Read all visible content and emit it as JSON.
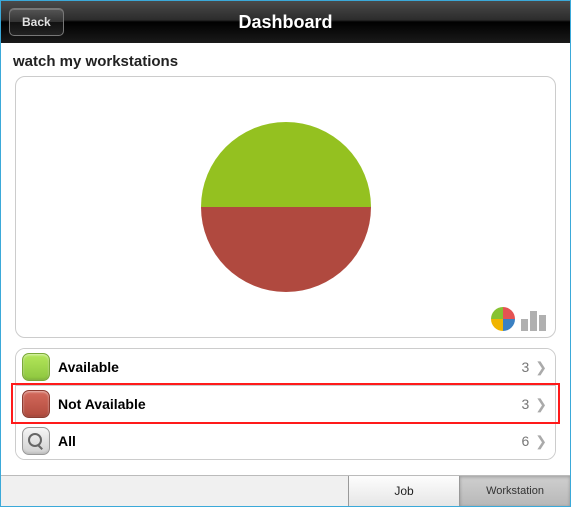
{
  "header": {
    "back_label": "Back",
    "title": "Dashboard"
  },
  "panel": {
    "title": "watch my workstations"
  },
  "chart_data": {
    "type": "pie",
    "title": "",
    "series": [
      {
        "name": "Available",
        "value": 3,
        "color": "#94c120"
      },
      {
        "name": "Not Available",
        "value": 3,
        "color": "#b0493f"
      }
    ],
    "total": 6
  },
  "legend": [
    {
      "label": "Available",
      "count": "3",
      "color": "green"
    },
    {
      "label": "Not Available",
      "count": "3",
      "color": "red"
    },
    {
      "label": "All",
      "count": "6",
      "color": "gray",
      "icon": "magnifier"
    }
  ],
  "view_toggles": {
    "pie": "pie-chart-icon",
    "bar": "bar-chart-icon"
  },
  "tabs": {
    "job": "Job",
    "workstation": "Workstation",
    "active": "workstation"
  }
}
